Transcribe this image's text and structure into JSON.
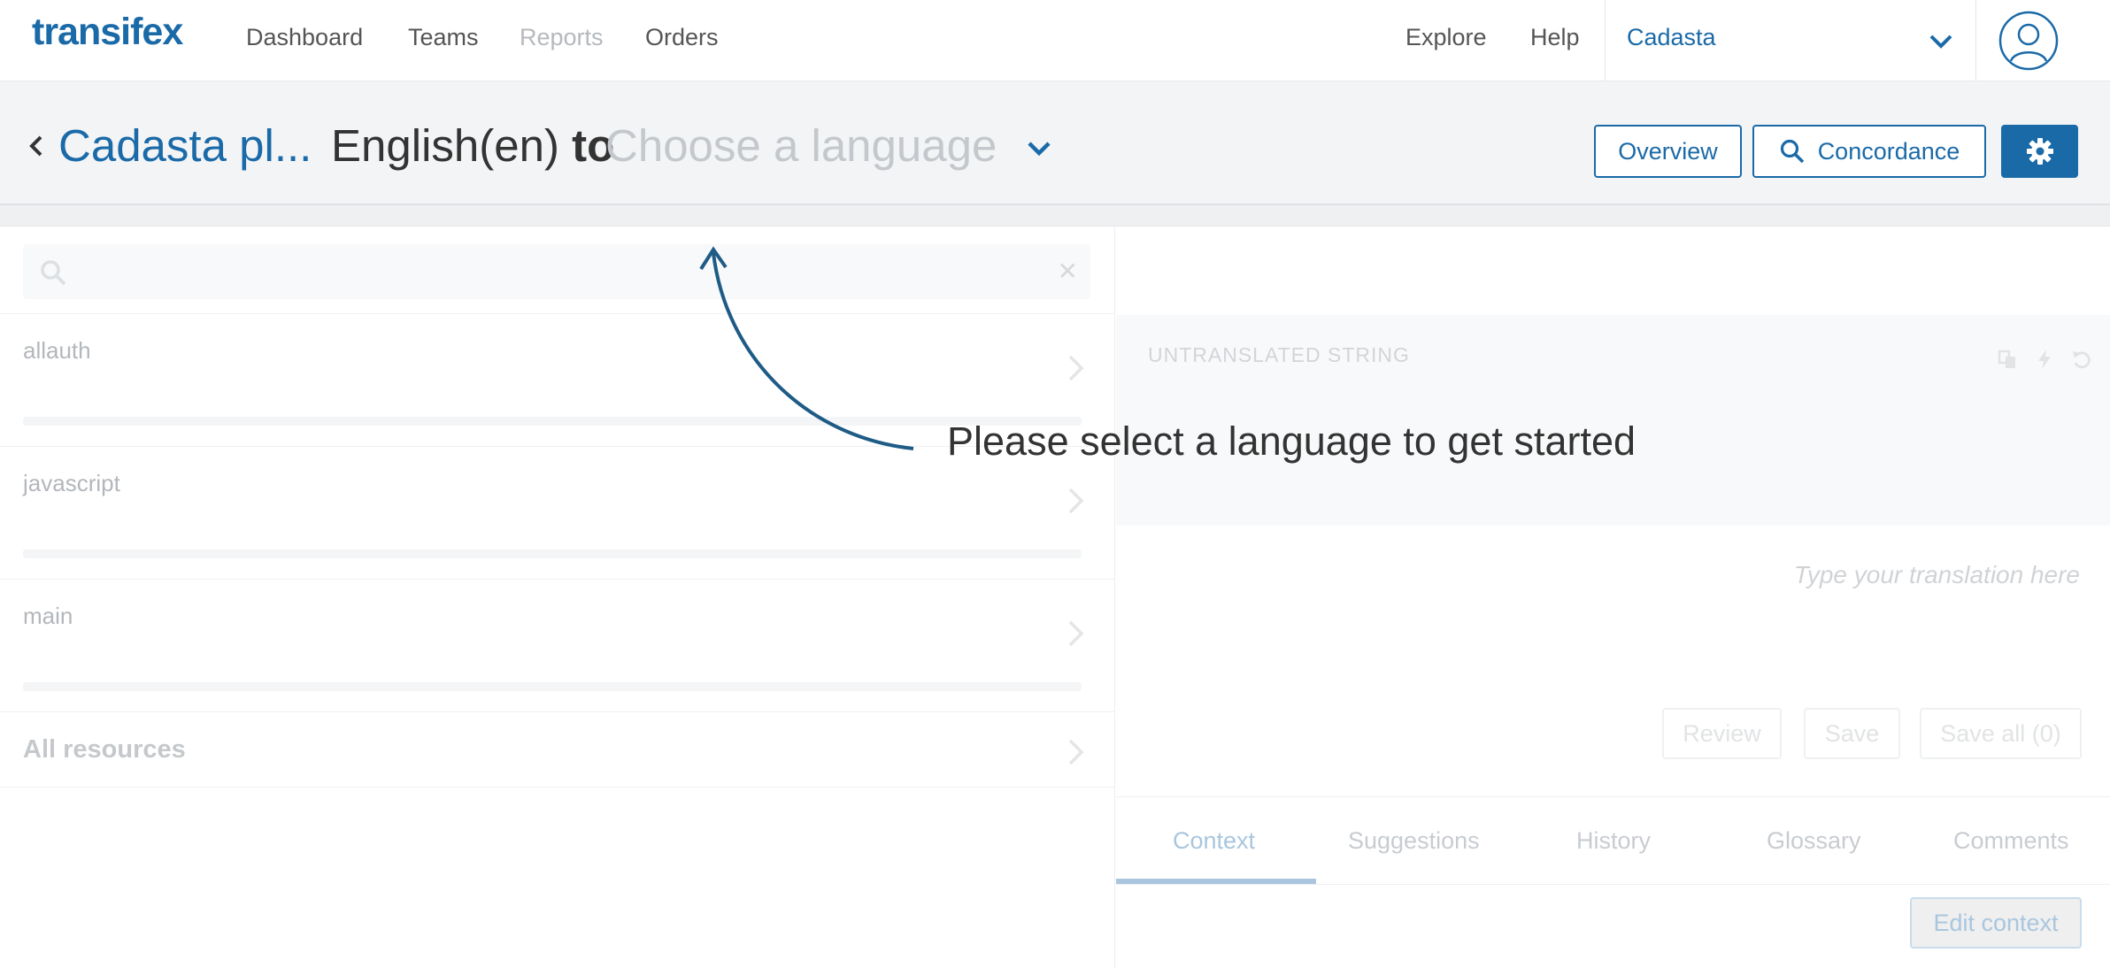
{
  "nav": {
    "logo": "transifex",
    "links": [
      "Dashboard",
      "Teams",
      "Reports",
      "Orders"
    ],
    "right_links": [
      "Explore",
      "Help"
    ],
    "organization": "Cadasta"
  },
  "editor_header": {
    "project": "Cadasta pl...",
    "source_language": "English(en)",
    "to_word": "to",
    "target_placeholder": "Choose a language",
    "buttons": {
      "overview": "Overview",
      "concordance": "Concordance"
    }
  },
  "resources": {
    "items": [
      "allauth",
      "javascript",
      "main"
    ],
    "all_label": "All resources"
  },
  "string_panel": {
    "label": "UNTRANSLATED STRING",
    "translation_placeholder": "Type your translation here",
    "actions": {
      "review": "Review",
      "save": "Save",
      "save_all": "Save all (0)"
    },
    "tabs": [
      "Context",
      "Suggestions",
      "History",
      "Glossary",
      "Comments"
    ],
    "active_tab": "Context",
    "edit_context": "Edit context"
  },
  "overlay_hint": "Please select a language to get started",
  "colors": {
    "brand": "#1b6aa8"
  }
}
